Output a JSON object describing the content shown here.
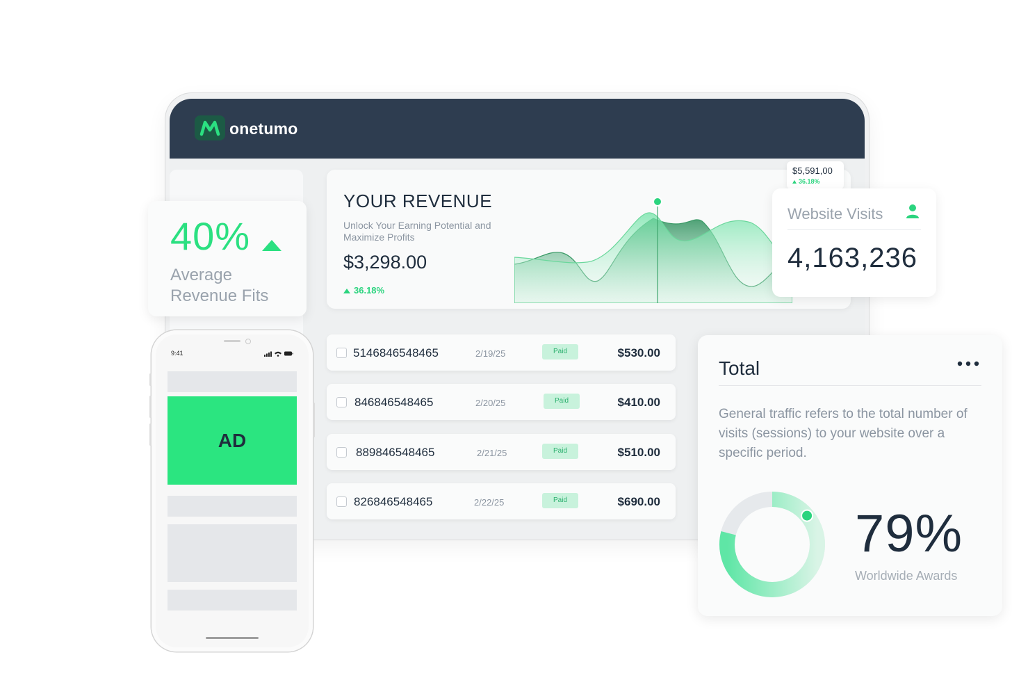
{
  "brand": {
    "name": "onetumo",
    "logo_letter": "M",
    "accent": "#2be081",
    "navy": "#2e3d50"
  },
  "revenue": {
    "title": "YOUR REVENUE",
    "subtitle": "Unlock Your Earning Potential and Maximize Profits",
    "amount": "$3,298.00",
    "change": "36.18%",
    "tooltip": {
      "value": "$5,591,00",
      "change": "36.18%"
    }
  },
  "transactions": [
    {
      "id": "5146846548465",
      "date": "2/19/25",
      "status": "Paid",
      "amount": "$530.00"
    },
    {
      "id": "846846548465",
      "date": "2/20/25",
      "status": "Paid",
      "amount": "$410.00"
    },
    {
      "id": "889846548465",
      "date": "2/21/25",
      "status": "Paid",
      "amount": "$510.00"
    },
    {
      "id": "826846548465",
      "date": "2/22/25",
      "status": "Paid",
      "amount": "$690.00"
    }
  ],
  "average": {
    "value": "40%",
    "label": "Average Revenue Fits",
    "icon": "triangle-up-icon"
  },
  "visits": {
    "title": "Website Visits",
    "value": "4,163,236",
    "icon": "person-icon"
  },
  "total": {
    "title": "Total",
    "description": "General traffic refers to the total number of visits (sessions) to your website over a specific period.",
    "percent": "79%",
    "progress": 0.79,
    "caption": "Worldwide Awards",
    "menu_icon": "more-horizontal-icon"
  },
  "phone": {
    "time": "9:41",
    "ad_label": "AD"
  }
}
